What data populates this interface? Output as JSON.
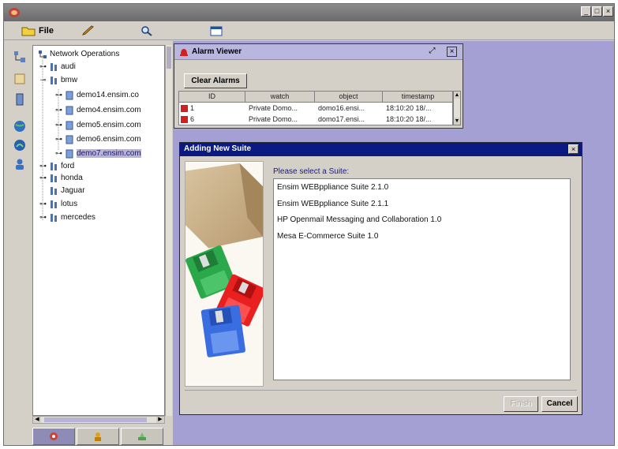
{
  "app": {
    "title": "",
    "menus": [
      {
        "label": "File",
        "icon": "folder-icon"
      },
      {
        "label": "",
        "icon": "pencil-icon"
      },
      {
        "label": "",
        "icon": "magnifier-icon"
      },
      {
        "label": "",
        "icon": "window-icon"
      }
    ]
  },
  "tree": {
    "root": "Network Operations",
    "nodes": [
      {
        "label": "audi",
        "level": 1,
        "expanded": false
      },
      {
        "label": "bmw",
        "level": 1,
        "expanded": true
      },
      {
        "label": "demo14.ensim.co",
        "level": 2,
        "expanded": false
      },
      {
        "label": "demo4.ensim.com",
        "level": 2,
        "expanded": false
      },
      {
        "label": "demo5.ensim.com",
        "level": 2,
        "expanded": false
      },
      {
        "label": "demo6.ensim.com",
        "level": 2,
        "expanded": false
      },
      {
        "label": "demo7.ensim.com",
        "level": 2,
        "expanded": false,
        "selected": true
      },
      {
        "label": "ford",
        "level": 1,
        "expanded": false
      },
      {
        "label": "honda",
        "level": 1,
        "expanded": false
      },
      {
        "label": "Jaguar",
        "level": 1,
        "expanded": false
      },
      {
        "label": "lotus",
        "level": 1,
        "expanded": false
      },
      {
        "label": "mercedes",
        "level": 1,
        "expanded": false
      }
    ]
  },
  "alarm_viewer": {
    "title": "Alarm Viewer",
    "clear_button": "Clear Alarms",
    "columns": [
      "ID",
      "watch",
      "object",
      "timestamp"
    ],
    "rows": [
      {
        "id": "1",
        "watch": "Private Domo...",
        "object": "domo16.ensi...",
        "timestamp": "18:10:20 18/..."
      },
      {
        "id": "6",
        "watch": "Private Domo...",
        "object": "domo17.ensi...",
        "timestamp": "18:10:20 18/..."
      }
    ]
  },
  "dialog": {
    "title": "Adding New Suite",
    "prompt": "Please select a Suite:",
    "suites": [
      "Ensim WEBppliance Suite 2.1.0",
      "Ensim WEBppliance Suite 2.1.1",
      "HP Openmail Messaging and Collaboration 1.0",
      "Mesa E-Commerce Suite 1.0"
    ],
    "finish_button": "Finish",
    "cancel_button": "Cancel"
  },
  "colors": {
    "desktop": "#a4a0d4",
    "dialog_title": "#0a1a82",
    "selection": "#b7b4d8"
  }
}
